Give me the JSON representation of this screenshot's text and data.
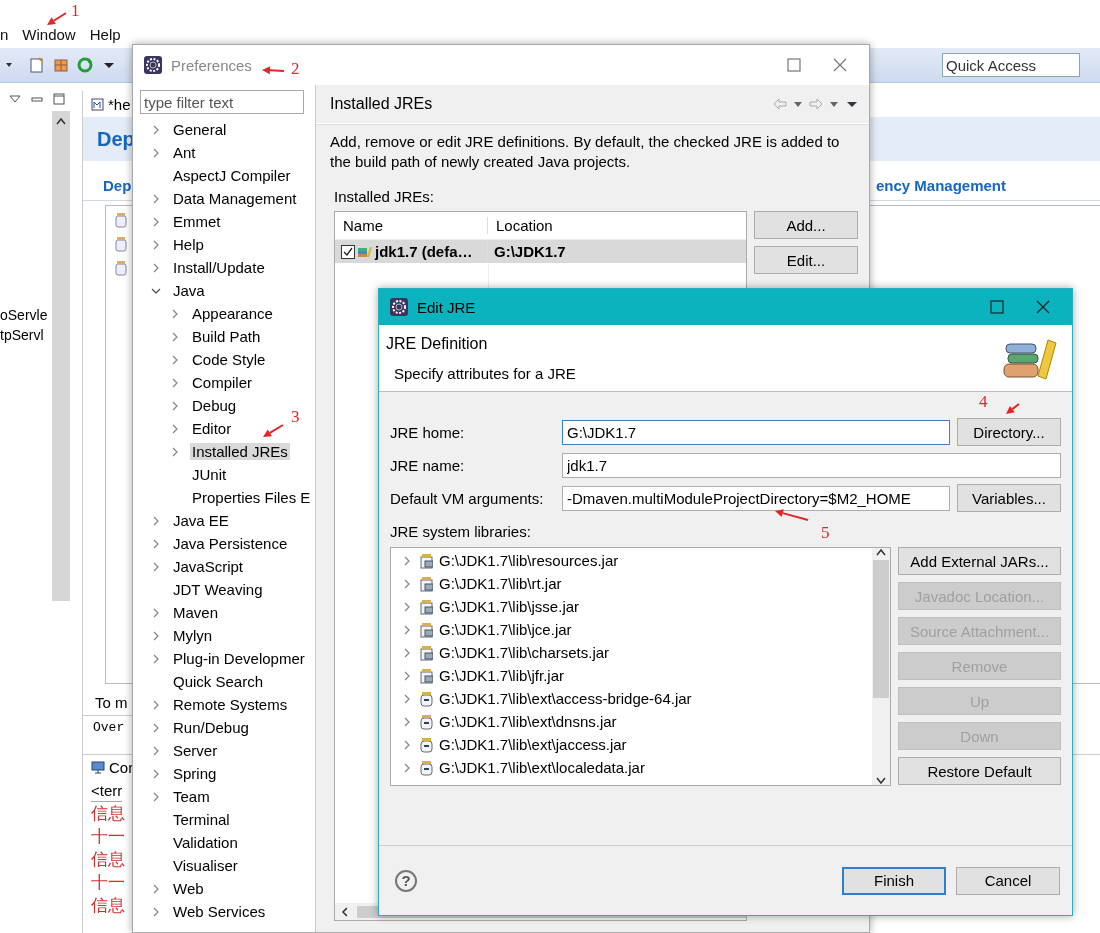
{
  "ide": {
    "menu": [
      {
        "label": "n"
      },
      {
        "label": "Window"
      },
      {
        "label": "Help"
      }
    ],
    "quick_access": {
      "placeholder": "Quick Access"
    },
    "explorer": {
      "items": [
        "oServle",
        "tpServl"
      ]
    },
    "editor": {
      "tab": "*he",
      "title": "Dep",
      "section_tabs": [
        "Dep",
        "ency Management"
      ],
      "hint": "To m",
      "page_tab": "Over"
    },
    "console": {
      "title": "Cor",
      "header": "<terr",
      "lines": [
        "信息",
        "十一",
        "信息",
        "十一",
        "信息"
      ]
    }
  },
  "preferences": {
    "title": "Preferences",
    "active": false,
    "filter": {
      "placeholder": "type filter text"
    },
    "tree": [
      {
        "label": "General",
        "kind": "folder",
        "expanded": false,
        "selected": false
      },
      {
        "label": "Ant",
        "kind": "folder",
        "expanded": false,
        "selected": false
      },
      {
        "label": "AspectJ Compiler",
        "kind": "leaf",
        "selected": false
      },
      {
        "label": "Data Management",
        "kind": "folder",
        "expanded": false,
        "selected": false
      },
      {
        "label": "Emmet",
        "kind": "folder",
        "expanded": false,
        "selected": false
      },
      {
        "label": "Help",
        "kind": "folder",
        "expanded": false,
        "selected": false
      },
      {
        "label": "Install/Update",
        "kind": "folder",
        "expanded": false,
        "selected": false
      },
      {
        "label": "Java",
        "kind": "folder",
        "expanded": true,
        "selected": false,
        "children": [
          {
            "label": "Appearance",
            "kind": "folder",
            "expanded": false,
            "selected": false
          },
          {
            "label": "Build Path",
            "kind": "folder",
            "expanded": false,
            "selected": false
          },
          {
            "label": "Code Style",
            "kind": "folder",
            "expanded": false,
            "selected": false
          },
          {
            "label": "Compiler",
            "kind": "folder",
            "expanded": false,
            "selected": false
          },
          {
            "label": "Debug",
            "kind": "folder",
            "expanded": false,
            "selected": false
          },
          {
            "label": "Editor",
            "kind": "folder",
            "expanded": false,
            "selected": false
          },
          {
            "label": "Installed JREs",
            "kind": "folder",
            "expanded": false,
            "selected": true
          },
          {
            "label": "JUnit",
            "kind": "leaf",
            "selected": false
          },
          {
            "label": "Properties Files E",
            "kind": "leaf",
            "selected": false
          }
        ]
      },
      {
        "label": "Java EE",
        "kind": "folder",
        "expanded": false,
        "selected": false
      },
      {
        "label": "Java Persistence",
        "kind": "folder",
        "expanded": false,
        "selected": false
      },
      {
        "label": "JavaScript",
        "kind": "folder",
        "expanded": false,
        "selected": false
      },
      {
        "label": "JDT Weaving",
        "kind": "leaf",
        "selected": false
      },
      {
        "label": "Maven",
        "kind": "folder",
        "expanded": false,
        "selected": false
      },
      {
        "label": "Mylyn",
        "kind": "folder",
        "expanded": false,
        "selected": false
      },
      {
        "label": "Plug-in Developmer",
        "kind": "folder",
        "expanded": false,
        "selected": false
      },
      {
        "label": "Quick Search",
        "kind": "leaf",
        "selected": false
      },
      {
        "label": "Remote Systems",
        "kind": "folder",
        "expanded": false,
        "selected": false
      },
      {
        "label": "Run/Debug",
        "kind": "folder",
        "expanded": false,
        "selected": false
      },
      {
        "label": "Server",
        "kind": "folder",
        "expanded": false,
        "selected": false
      },
      {
        "label": "Spring",
        "kind": "folder",
        "expanded": false,
        "selected": false
      },
      {
        "label": "Team",
        "kind": "folder",
        "expanded": false,
        "selected": false
      },
      {
        "label": "Terminal",
        "kind": "leaf",
        "selected": false
      },
      {
        "label": "Validation",
        "kind": "leaf",
        "selected": false
      },
      {
        "label": "Visualiser",
        "kind": "leaf",
        "selected": false
      },
      {
        "label": "Web",
        "kind": "folder",
        "expanded": false,
        "selected": false
      },
      {
        "label": "Web Services",
        "kind": "folder",
        "expanded": false,
        "selected": false
      }
    ],
    "page": {
      "title": "Installed JREs",
      "description": "Add, remove or edit JRE definitions. By default, the checked JRE is added to the build path of newly created Java projects.",
      "table_label": "Installed JREs:",
      "columns": [
        "Name",
        "Location"
      ],
      "rows": [
        {
          "checked": true,
          "selected": true,
          "name": "jdk1.7 (defa…",
          "location": "G:\\JDK1.7"
        }
      ],
      "buttons": [
        {
          "label": "Add..."
        },
        {
          "label": "Edit..."
        }
      ]
    }
  },
  "edit_jre": {
    "title": "Edit JRE",
    "heading": "JRE Definition",
    "subtitle": "Specify attributes for a JRE",
    "fields": [
      {
        "label": "JRE home:",
        "value": "G:\\JDK1.7",
        "focused": true,
        "button": "Directory..."
      },
      {
        "label": "JRE name:",
        "value": "jdk1.7",
        "focused": false
      },
      {
        "label": "Default VM arguments:",
        "value": "-Dmaven.multiModuleProjectDirectory=$M2_HOME",
        "focused": false,
        "button": "Variables..."
      }
    ],
    "libraries_label": "JRE system libraries:",
    "libraries": [
      {
        "path": "G:\\JDK1.7\\lib\\resources.jar",
        "kind": "lib"
      },
      {
        "path": "G:\\JDK1.7\\lib\\rt.jar",
        "kind": "lib"
      },
      {
        "path": "G:\\JDK1.7\\lib\\jsse.jar",
        "kind": "lib"
      },
      {
        "path": "G:\\JDK1.7\\lib\\jce.jar",
        "kind": "lib"
      },
      {
        "path": "G:\\JDK1.7\\lib\\charsets.jar",
        "kind": "lib"
      },
      {
        "path": "G:\\JDK1.7\\lib\\jfr.jar",
        "kind": "lib"
      },
      {
        "path": "G:\\JDK1.7\\lib\\ext\\access-bridge-64.jar",
        "kind": "ext"
      },
      {
        "path": "G:\\JDK1.7\\lib\\ext\\dnsns.jar",
        "kind": "ext"
      },
      {
        "path": "G:\\JDK1.7\\lib\\ext\\jaccess.jar",
        "kind": "ext"
      },
      {
        "path": "G:\\JDK1.7\\lib\\ext\\localedata.jar",
        "kind": "ext"
      }
    ],
    "library_buttons": [
      {
        "label": "Add External JARs...",
        "disabled": false
      },
      {
        "label": "Javadoc Location...",
        "disabled": true
      },
      {
        "label": "Source Attachment...",
        "disabled": true
      },
      {
        "label": "Remove",
        "disabled": true
      },
      {
        "label": "Up",
        "disabled": true
      },
      {
        "label": "Down",
        "disabled": true
      },
      {
        "label": "Restore Default",
        "disabled": false
      }
    ],
    "help": "?",
    "buttons": [
      {
        "label": "Finish",
        "default": true
      },
      {
        "label": "Cancel",
        "default": false
      }
    ]
  },
  "annotations": [
    "1",
    "2",
    "3",
    "4",
    "5"
  ]
}
